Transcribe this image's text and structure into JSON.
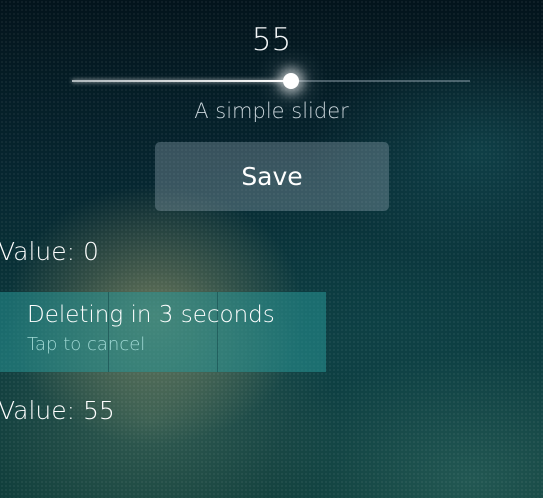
{
  "slider": {
    "value_text": "55",
    "value": 55,
    "min": 0,
    "max": 100,
    "label": "A simple slider"
  },
  "save_button": {
    "label": "Save"
  },
  "value_display_top": {
    "text": "Value: 0"
  },
  "remorse_popup": {
    "title": "Deleting in 3 seconds",
    "subtitle": "Tap to cancel",
    "countdown_progress": 0.67
  },
  "value_display_bottom": {
    "text": "Value: 55"
  },
  "colors": {
    "accent": "#2a9a9a",
    "background": "#07262c"
  }
}
